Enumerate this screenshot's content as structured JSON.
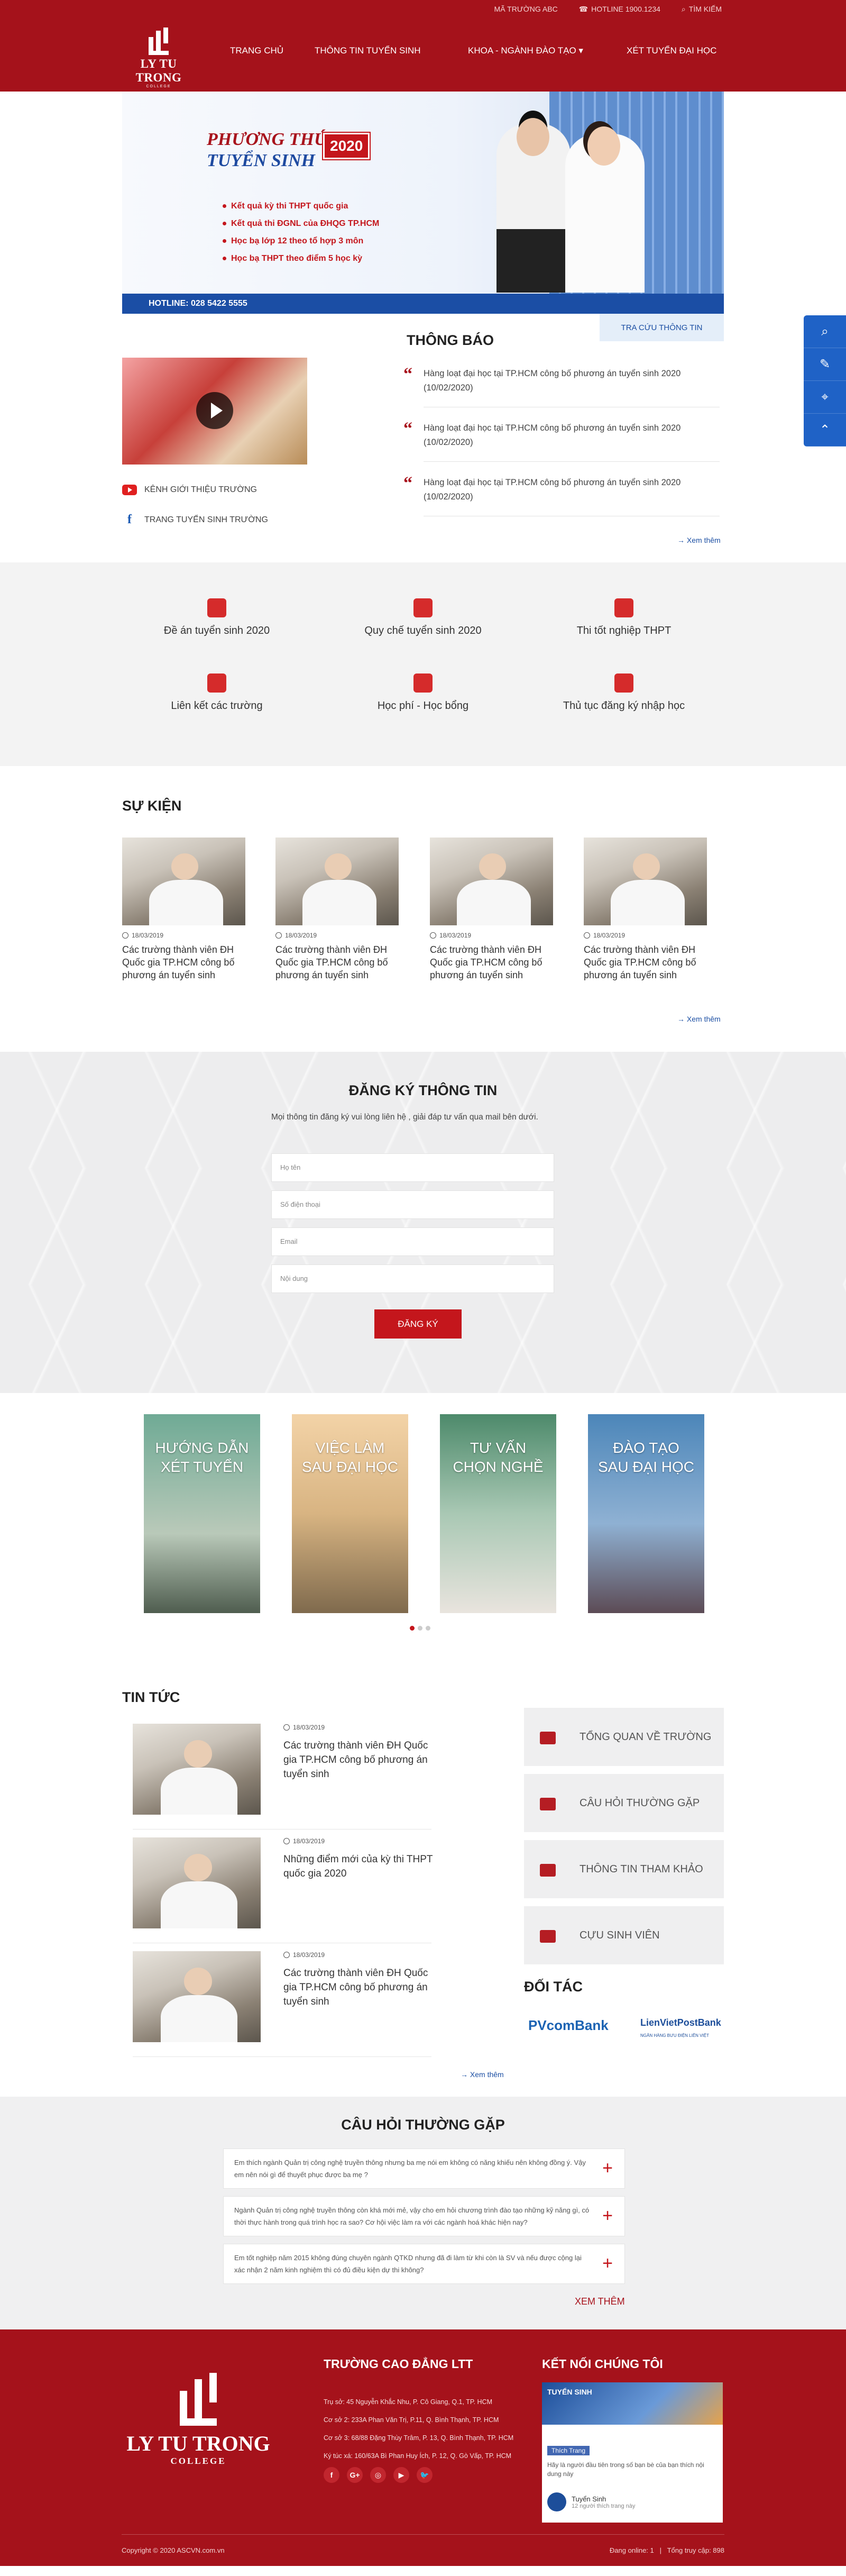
{
  "topbar": {
    "school_code": "MÃ TRƯỜNG ABC",
    "hotline": "HOTLINE 1900.1234",
    "search": "TÌM KIẾM"
  },
  "logo": {
    "name": "LY TU TRONG",
    "sub": "COLLEGE"
  },
  "nav": {
    "home": "TRANG CHỦ",
    "admissions": "THÔNG TIN TUYỂN SINH",
    "faculties": "KHOA - NGÀNH ĐÀO TẠO",
    "faculties_caret": "▾",
    "online": "XÉT TUYỂN ĐẠI HỌC"
  },
  "banner": {
    "line1": "PHƯƠNG THỨC",
    "line2": "TUYỂN SINH",
    "year": "2020",
    "items": [
      "Kết quả kỳ thi THPT quốc gia",
      "Kết quả thi ĐGNL của ĐHQG TP.HCM",
      "Học bạ lớp 12 theo tổ hợp 3 môn",
      "Học bạ THPT theo điểm 5 học kỳ"
    ],
    "hotline": "HOTLINE: 028 5422 5555"
  },
  "intro": {
    "lookup": "TRA CỨU THÔNG TIN",
    "youtube": "KÊNH GIỚI THIỆU TRƯỜNG",
    "facebook": "TRANG TUYỂN SINH TRƯỜNG",
    "notice_title": "THÔNG BÁO",
    "notices": [
      "Hàng loạt đại học tại TP.HCM công bố phương án tuyển sinh 2020 (10/02/2020)",
      "Hàng loạt đại học tại TP.HCM công bố phương án tuyển sinh 2020 (10/02/2020)",
      "Hàng loạt đại học tại TP.HCM công bố phương án tuyển sinh 2020 (10/02/2020)"
    ],
    "more": "Xem thêm"
  },
  "quick": [
    "Đề án tuyển sinh 2020",
    "Quy chế tuyển sinh 2020",
    "Thi tốt nghiệp THPT",
    "Liên kết các trường",
    "Học phí - Học bổng",
    "Thủ tục đăng ký nhập học"
  ],
  "events": {
    "title": "SỰ KIỆN",
    "items": [
      {
        "date": "18/03/2019",
        "title": "Các trường thành viên ĐH Quốc gia TP.HCM công bố phương án tuyển sinh"
      },
      {
        "date": "18/03/2019",
        "title": "Các trường thành viên ĐH Quốc gia TP.HCM công bố phương án tuyển sinh"
      },
      {
        "date": "18/03/2019",
        "title": "Các trường thành viên ĐH Quốc gia TP.HCM công bố phương án tuyển sinh"
      },
      {
        "date": "18/03/2019",
        "title": "Các trường thành viên ĐH Quốc gia TP.HCM công bố phương án tuyển sinh"
      }
    ],
    "more": "Xem thêm"
  },
  "register": {
    "title": "ĐĂNG KÝ THÔNG TIN",
    "desc": "Mọi thông tin đăng ký vui lòng liên hệ , giải đáp tư vấn qua mail bên dưới.",
    "name_ph": "Họ tên",
    "phone_ph": "Số điện thoại",
    "email_ph": "Email",
    "content_ph": "Nội dung",
    "submit": "ĐĂNG KÝ"
  },
  "cards": [
    {
      "l1": "HƯỚNG DẪN",
      "l2": "XÉT TUYỂN"
    },
    {
      "l1": "VIỆC LÀM",
      "l2": "SAU ĐẠI HỌC"
    },
    {
      "l1": "TƯ VẤN",
      "l2": "CHỌN NGHỀ"
    },
    {
      "l1": "ĐÀO TẠO",
      "l2": "SAU ĐẠI HỌC"
    }
  ],
  "news": {
    "title": "TIN TỨC",
    "items": [
      {
        "date": "18/03/2019",
        "title": "Các trường thành viên ĐH Quốc gia TP.HCM công bố phương án tuyển sinh"
      },
      {
        "date": "18/03/2019",
        "title": "Những điểm mới của kỳ thi THPT quốc gia 2020"
      },
      {
        "date": "18/03/2019",
        "title": "Các trường thành viên ĐH Quốc gia TP.HCM công bố phương án tuyển sinh"
      }
    ],
    "more": "Xem thêm",
    "side": [
      "TỔNG QUAN VỀ TRƯỜNG",
      "CÂU HỎI THƯỜNG GẶP",
      "THÔNG TIN THAM KHẢO",
      "CỰU SINH VIÊN"
    ],
    "partners_title": "ĐỐI TÁC",
    "partner1": "PVcomBank",
    "partner2": "LienVietPostBank",
    "partner2_sub": "NGÂN HÀNG BƯU ĐIỆN LIÊN VIỆT"
  },
  "faq": {
    "title": "CÂU HỎI THƯỜNG GẶP",
    "items": [
      "Em thích ngành Quản trị công nghệ truyền thông nhưng ba mẹ nói em không có năng khiếu nên không đồng ý. Vậy em nên nói gì để thuyết phục được ba mẹ ?",
      "Ngành Quản trị công nghệ truyền thông còn khá mới mẻ, vậy cho em hỏi chương trình đào tạo những kỹ năng gì, có thời thực hành trong quá trình học ra sao? Cơ hội việc làm ra với các ngành hoá khác hiện nay?",
      "Em tốt nghiệp năm 2015 không đúng chuyên ngành QTKD nhưng đã đi làm từ khi còn là SV và nếu được cộng lại xác nhận 2 năm kinh nghiệm thì có đủ điều kiện dự thi không?"
    ],
    "more": "XEM THÊM"
  },
  "footer": {
    "logo_name": "LY TU TRONG",
    "logo_sub": "COLLEGE",
    "school": "TRƯỜNG CAO ĐẲNG LTT",
    "addresses": [
      "Trụ sở: 45 Nguyễn Khắc Nhu, P. Cô Giang, Q.1, TP. HCM",
      "Cơ sở 2: 233A Phan Văn Trị, P.11, Q. Bình Thạnh, TP. HCM",
      "Cơ sở 3: 68/88 Đặng Thùy Trâm, P. 13, Q. Bình Thạnh, TP. HCM",
      "Ký túc xá: 160/63A Bì Phan Huy Ích, P. 12, Q. Gò Vấp, TP. HCM"
    ],
    "social": [
      "f",
      "G+",
      "◎",
      "▶",
      "🐦"
    ],
    "connect": "KẾT NỐI CHÚNG TÔI",
    "fb_cover": "TUYỂN SINH",
    "fb_like": "Thích Trang",
    "fb_msg": "Hãy là người đầu tiên trong số bạn bè của bạn thích nội dung này",
    "fb_name": "Tuyển Sinh",
    "fb_followers": "12 người thích trang này",
    "copyright": "Copyright © 2020 ASCVN.com.vn",
    "online": "Đang online: 1",
    "visits": "Tổng truy cập: 898"
  }
}
